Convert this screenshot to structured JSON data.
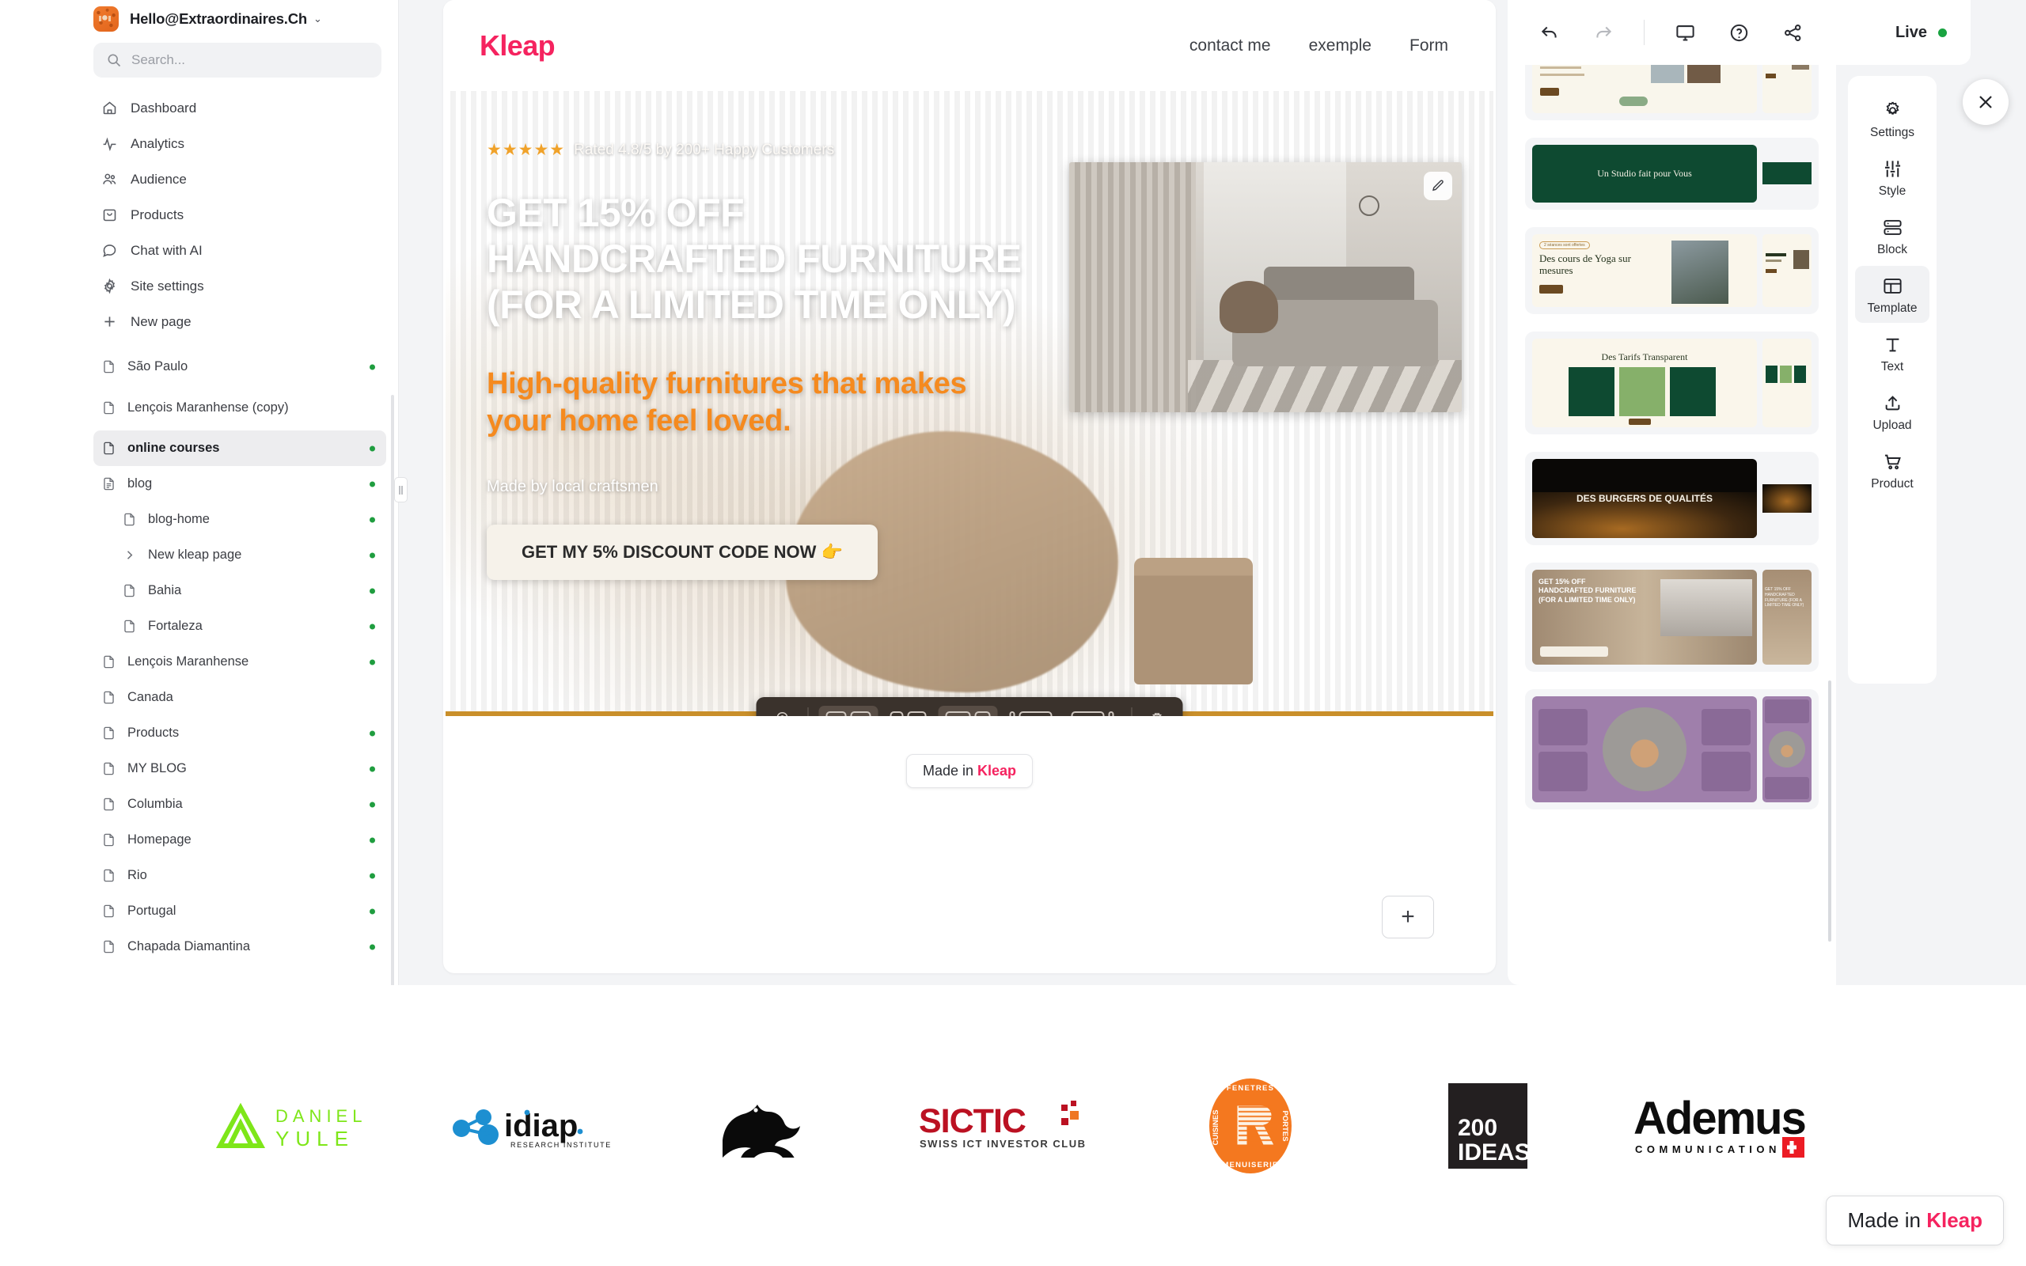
{
  "sidebar": {
    "workspace": {
      "name": "Hello@Extraordinaires.Ch",
      "caret": "chevron-down"
    },
    "search": {
      "placeholder": "Search...",
      "value": ""
    },
    "nav": [
      {
        "label": "Dashboard",
        "icon": "home-icon"
      },
      {
        "label": "Analytics",
        "icon": "activity-icon"
      },
      {
        "label": "Audience",
        "icon": "users-icon"
      },
      {
        "label": "Products",
        "icon": "bag-icon"
      },
      {
        "label": "Chat with AI",
        "icon": "chat-icon"
      },
      {
        "label": "Site settings",
        "icon": "gear-icon"
      },
      {
        "label": "New page",
        "icon": "plus-icon"
      }
    ],
    "pages": [
      {
        "label": "São Paulo",
        "published": true,
        "indent": false,
        "active": false,
        "icon": "file-icon"
      },
      {
        "label": "Lençois Maranhense (copy)",
        "published": false,
        "indent": false,
        "active": false,
        "icon": "file-icon",
        "multiline": true
      },
      {
        "label": "online courses",
        "published": true,
        "indent": false,
        "active": true,
        "icon": "file-icon"
      },
      {
        "label": "blog",
        "published": true,
        "indent": false,
        "active": false,
        "icon": "doc-lines-icon"
      },
      {
        "label": "blog-home",
        "published": true,
        "indent": true,
        "active": false,
        "icon": "file-icon"
      },
      {
        "label": "New kleap page",
        "published": true,
        "indent": true,
        "active": false,
        "icon": "chevron-right-icon"
      },
      {
        "label": "Bahia",
        "published": true,
        "indent": true,
        "active": false,
        "icon": "file-icon"
      },
      {
        "label": "Fortaleza",
        "published": true,
        "indent": true,
        "active": false,
        "icon": "file-icon"
      },
      {
        "label": "Lençois Maranhense",
        "published": true,
        "indent": false,
        "active": false,
        "icon": "file-icon"
      },
      {
        "label": "Canada",
        "published": false,
        "indent": false,
        "active": false,
        "icon": "file-icon"
      },
      {
        "label": "Products",
        "published": true,
        "indent": false,
        "active": false,
        "icon": "file-icon"
      },
      {
        "label": "MY BLOG",
        "published": true,
        "indent": false,
        "active": false,
        "icon": "file-icon"
      },
      {
        "label": "Columbia",
        "published": true,
        "indent": false,
        "active": false,
        "icon": "file-icon"
      },
      {
        "label": "Homepage",
        "published": true,
        "indent": false,
        "active": false,
        "icon": "file-icon"
      },
      {
        "label": "Rio",
        "published": true,
        "indent": false,
        "active": false,
        "icon": "file-icon"
      },
      {
        "label": "Portugal",
        "published": true,
        "indent": false,
        "active": false,
        "icon": "file-icon"
      },
      {
        "label": "Chapada Diamantina",
        "published": true,
        "indent": false,
        "active": false,
        "icon": "file-icon"
      }
    ]
  },
  "topbar": {
    "undo": "undo-icon",
    "redo": "redo-icon",
    "desktop": "desktop-icon",
    "help": "help-circle-icon",
    "share": "share-icon",
    "status_label": "Live",
    "status_color": "#19a341"
  },
  "right_rail": [
    {
      "label": "Settings",
      "icon": "gear-icon",
      "active": false
    },
    {
      "label": "Style",
      "icon": "sliders-icon",
      "active": false
    },
    {
      "label": "Block",
      "icon": "rows-icon",
      "active": false
    },
    {
      "label": "Template",
      "icon": "layout-icon",
      "active": true
    },
    {
      "label": "Text",
      "icon": "text-icon",
      "active": false
    },
    {
      "label": "Upload",
      "icon": "upload-icon",
      "active": false
    },
    {
      "label": "Product",
      "icon": "cart-icon",
      "active": false
    }
  ],
  "template_panel": {
    "close_icon": "close-icon",
    "items": [
      {
        "name": "yoga-list-template",
        "theme": "cream",
        "title": ""
      },
      {
        "name": "yoga-studio-template",
        "theme": "green",
        "title": "Un Studio fait pour Vous"
      },
      {
        "name": "yoga-courses-template",
        "theme": "cream",
        "title": "Des cours de Yoga sur mesures",
        "badge": "2 séances sont offertes"
      },
      {
        "name": "pricing-template",
        "theme": "cream",
        "title": "Des Tarifs Transparent"
      },
      {
        "name": "burger-template",
        "theme": "dark",
        "title": "DES BURGERS DE QUALITÉS"
      },
      {
        "name": "furniture-template",
        "theme": "beige",
        "title": "GET 15% OFF HANDCRAFTED FURNITURE (FOR A LIMITED TIME ONLY)"
      },
      {
        "name": "cosmetics-template",
        "theme": "purple",
        "title": ""
      }
    ]
  },
  "canvas": {
    "site": {
      "logo": "Kleap",
      "nav_links": [
        "contact me",
        "exemple",
        "Form"
      ]
    },
    "hero": {
      "stars": "★★★★★",
      "rating_text": "Rated 4.8/5 by 200+ Happy Customers",
      "heading": "GET 15% OFF HANDCRAFTED FURNITURE (FOR A LIMITED TIME ONLY)",
      "subheading": "High-quality furnitures that makes your home feel loved.",
      "kicker": "Made by local craftsmen",
      "cta_label": "GET MY 5% DISCOUNT CODE NOW 👉",
      "image_edit_icon": "pencil-icon"
    },
    "block_toolbar": {
      "target_icon": "target-icon",
      "layouts": [
        "two-equal",
        "two-equal-small",
        "two-equal-large",
        "left-small-right-large",
        "left-large-right-small"
      ],
      "selected_layout": "two-equal",
      "hovered_layout": "two-equal",
      "delete_icon": "trash-icon"
    },
    "made_badge": {
      "prefix": "Made in ",
      "brand": "Kleap"
    },
    "add_block_label": "+"
  },
  "logo_strip": [
    {
      "name": "daniel-yule-logo",
      "text_top": "DANIEL",
      "text_bottom": "YULE",
      "color": "#7ee619"
    },
    {
      "name": "idiap-logo",
      "text": "idiap",
      "subtext": "RESEARCH INSTITUTE",
      "color": "#1d8fd1"
    },
    {
      "name": "lion-logo",
      "text": "",
      "color": "#000000"
    },
    {
      "name": "sictic-logo",
      "text": "SICTIC",
      "subtext": "SWISS ICT INVESTOR CLUB",
      "color": "#bb1122"
    },
    {
      "name": "menuiserie-r-logo",
      "text": "R",
      "subtext": "CUISINES · FENETRES · PORTES · MENUISERIE",
      "color": "#f4781f"
    },
    {
      "name": "200-ideas-logo",
      "text_top": "200",
      "text_bottom": "IDEAS",
      "color": "#231f20"
    },
    {
      "name": "ademus-logo",
      "text": "Ademus",
      "subtext": "COMMUNICATION",
      "color": "#0d0d0d"
    }
  ],
  "made_badge_fixed": {
    "prefix": "Made in ",
    "brand": "Kleap"
  }
}
